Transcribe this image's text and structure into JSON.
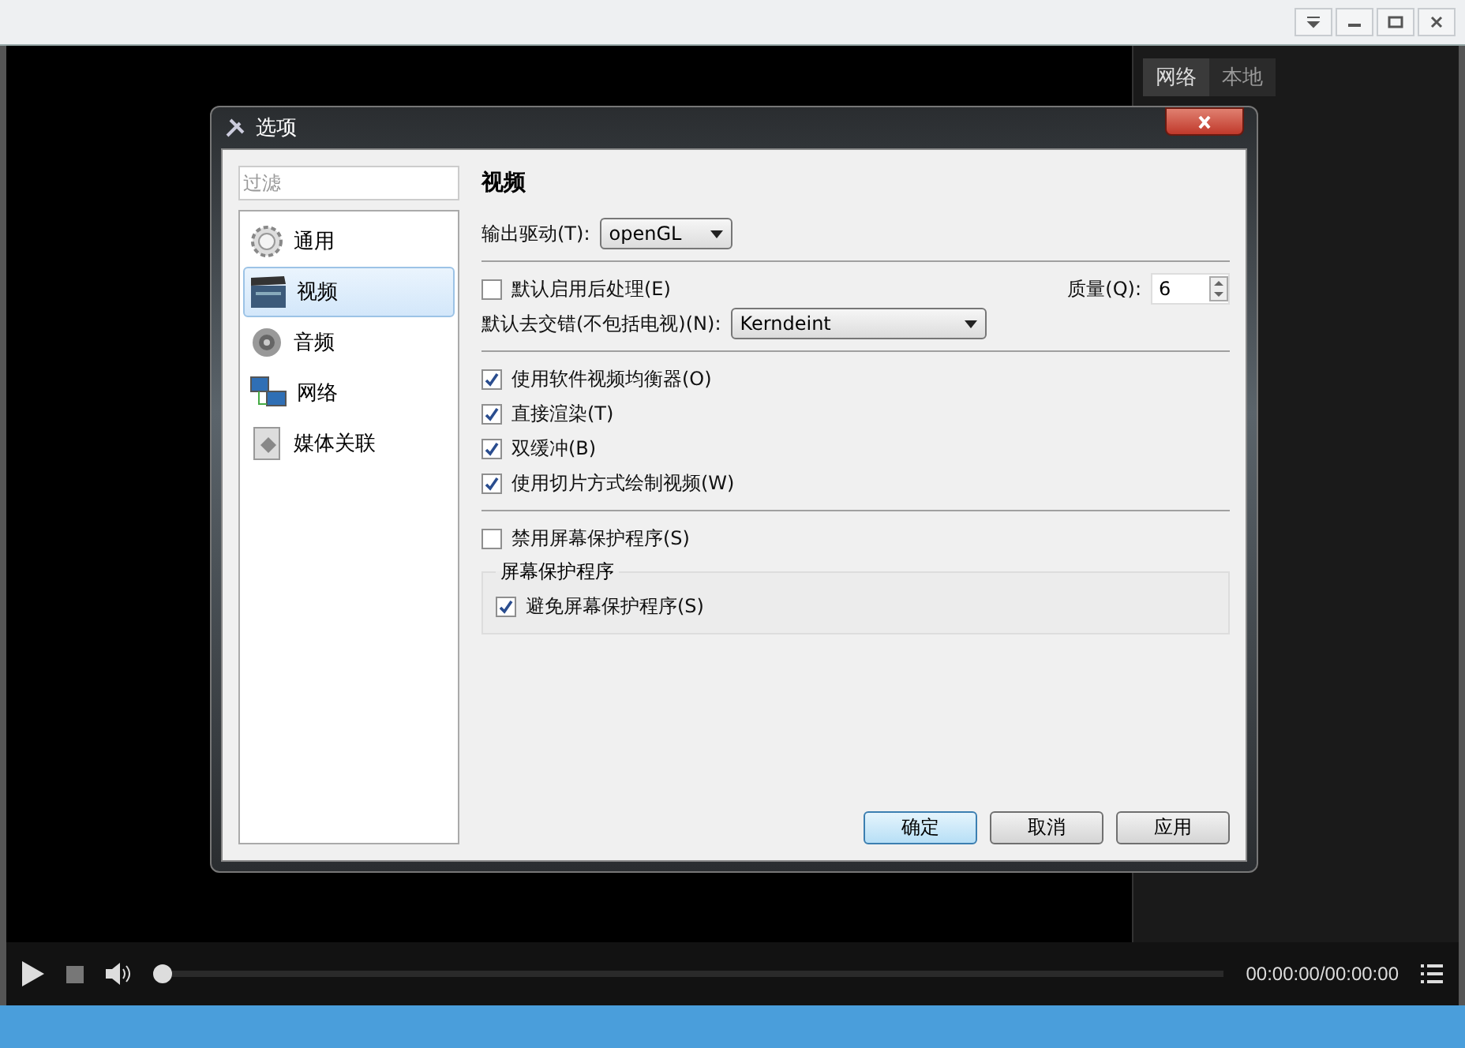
{
  "side_panel": {
    "tabs": [
      {
        "label": "网络",
        "selected": true
      },
      {
        "label": "本地",
        "selected": false
      }
    ]
  },
  "dialog": {
    "title": "选项",
    "filter": {
      "placeholder": "过滤"
    },
    "categories": [
      {
        "label": "通用",
        "selected": false,
        "kind": "gear"
      },
      {
        "label": "视频",
        "selected": true,
        "kind": "video"
      },
      {
        "label": "音频",
        "selected": false,
        "kind": "audio"
      },
      {
        "label": "网络",
        "selected": false,
        "kind": "network"
      },
      {
        "label": "媒体关联",
        "selected": false,
        "kind": "media"
      }
    ],
    "section_title": "视频",
    "output_driver": {
      "label": "输出驱动(T):",
      "value": "openGL"
    },
    "postprocess": {
      "label": "默认启用后处理(E)",
      "checked": false
    },
    "quality": {
      "label": "质量(Q):",
      "value": "6"
    },
    "deinterlace": {
      "label": "默认去交错(不包括电视)(N):",
      "value": "Kerndeint"
    },
    "options": [
      {
        "label": "使用软件视频均衡器(O)",
        "checked": true
      },
      {
        "label": "直接渲染(T)",
        "checked": true
      },
      {
        "label": "双缓冲(B)",
        "checked": true
      },
      {
        "label": "使用切片方式绘制视频(W)",
        "checked": true
      }
    ],
    "disable_screensaver": {
      "label": "禁用屏幕保护程序(S)",
      "checked": false
    },
    "group": {
      "title": "屏幕保护程序",
      "options": [
        {
          "label": "避免屏幕保护程序(S)",
          "checked": true
        }
      ]
    },
    "buttons": [
      {
        "label": "确定",
        "default": true
      },
      {
        "label": "取消",
        "default": false
      },
      {
        "label": "应用",
        "default": false
      }
    ]
  },
  "player": {
    "seek": {
      "level": 0
    },
    "time": "00:00:00/00:00:00"
  }
}
